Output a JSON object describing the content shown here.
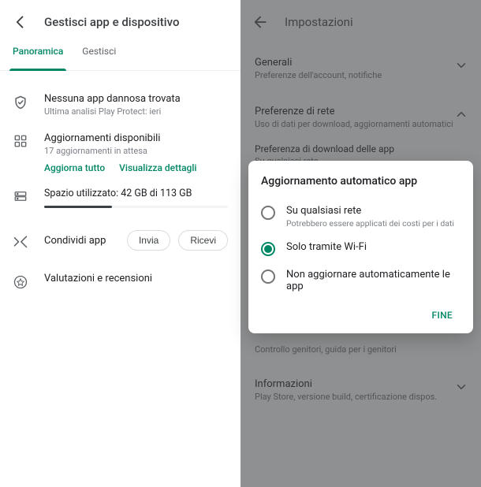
{
  "left": {
    "title": "Gestisci app e dispositivo",
    "tabs": {
      "overview": "Panoramica",
      "manage": "Gestisci"
    },
    "protect": {
      "title": "Nessuna app dannosa trovata",
      "sub": "Ultima analisi Play Protect: ieri"
    },
    "updates": {
      "title": "Aggiornamenti disponibili",
      "sub": "17 aggiornamenti in attesa",
      "update_all": "Aggiorna tutto",
      "view_details": "Visualizza dettagli"
    },
    "storage": {
      "title": "Spazio utilizzato: 42 GB di 113 GB"
    },
    "share": {
      "title": "Condividi app",
      "send": "Invia",
      "receive": "Ricevi"
    },
    "ratings": {
      "title": "Valutazioni e recensioni"
    }
  },
  "right": {
    "title": "Impostazioni",
    "general": {
      "title": "Generali",
      "sub": "Preferenze dell'account, notifiche"
    },
    "network": {
      "title": "Preferenze di rete",
      "sub": "Uso di dati per download, aggiornamenti automatici",
      "download_pref_title": "Preferenza di download delle app",
      "download_pref_sub": "Su qualsiasi rete"
    },
    "family": {
      "title": "Controllo genitori, guida per i genitori"
    },
    "info": {
      "title": "Informazioni",
      "sub": "Play Store, versione build, certificazione dispos."
    }
  },
  "dialog": {
    "title": "Aggiornamento automatico app",
    "options": [
      {
        "label": "Su qualsiasi rete",
        "sub": "Potrebbero essere applicati dei costi per i dati",
        "checked": false
      },
      {
        "label": "Solo tramite Wi-Fi",
        "sub": "",
        "checked": true
      },
      {
        "label": "Non aggiornare automaticamente le app",
        "sub": "",
        "checked": false
      }
    ],
    "done": "FINE"
  }
}
